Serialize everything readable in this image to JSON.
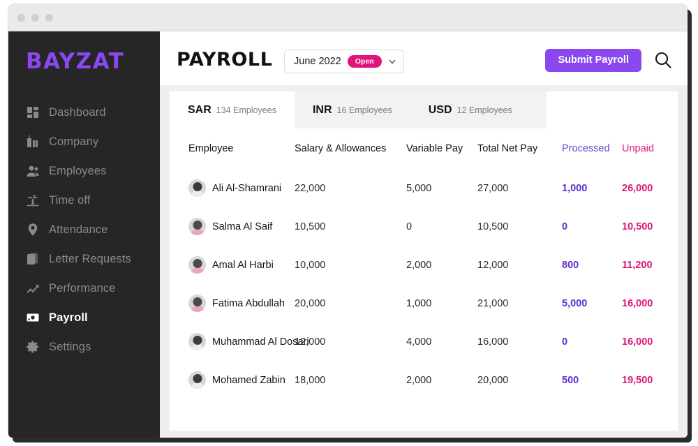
{
  "window": {
    "traffic_lights": [
      "close",
      "minimize",
      "maximize"
    ]
  },
  "sidebar": {
    "logo": "BAYZAT",
    "logo_color": "#8b47f0",
    "items": [
      {
        "label": "Dashboard",
        "icon": "dashboard-icon",
        "active": false
      },
      {
        "label": "Company",
        "icon": "building-icon",
        "active": false
      },
      {
        "label": "Employees",
        "icon": "people-icon",
        "active": false
      },
      {
        "label": "Time off",
        "icon": "palm-tree-icon",
        "active": false
      },
      {
        "label": "Attendance",
        "icon": "map-pin-icon",
        "active": false
      },
      {
        "label": "Letter Requests",
        "icon": "document-icon",
        "active": false
      },
      {
        "label": "Performance",
        "icon": "trending-up-icon",
        "active": false
      },
      {
        "label": "Payroll",
        "icon": "money-card-icon",
        "active": true
      },
      {
        "label": "Settings",
        "icon": "gear-icon",
        "active": false
      }
    ]
  },
  "header": {
    "title": "PAYROLL",
    "period": {
      "label": "June 2022",
      "status": "Open",
      "status_color": "#e0157c",
      "chevron": "chevron-down-icon"
    },
    "submit_label": "Submit Payroll",
    "submit_color": "#8b47f0",
    "search_icon": "search-icon"
  },
  "tabs": [
    {
      "code": "SAR",
      "count": "134 Employees",
      "active": true
    },
    {
      "code": "INR",
      "count": "16 Employees",
      "active": false
    },
    {
      "code": "USD",
      "count": "12 Employees",
      "active": false
    }
  ],
  "table": {
    "columns": [
      {
        "key": "employee",
        "label": "Employee",
        "color": "#121212"
      },
      {
        "key": "salary",
        "label": "Salary & Allowances",
        "color": "#121212"
      },
      {
        "key": "variable",
        "label": "Variable Pay",
        "color": "#121212"
      },
      {
        "key": "total",
        "label": "Total Net Pay",
        "color": "#121212"
      },
      {
        "key": "processed",
        "label": "Processed",
        "color": "#6b45d4"
      },
      {
        "key": "unpaid",
        "label": "Unpaid",
        "color": "#e0157c"
      }
    ],
    "rows": [
      {
        "employee": "Ali Al-Shamrani",
        "avatar": "m",
        "salary": "22,000",
        "variable": "5,000",
        "total": "27,000",
        "processed": "1,000",
        "unpaid": "26,000"
      },
      {
        "employee": "Salma Al Saif",
        "avatar": "f",
        "salary": "10,500",
        "variable": "0",
        "total": "10,500",
        "processed": "0",
        "unpaid": "10,500"
      },
      {
        "employee": "Amal Al Harbi",
        "avatar": "f",
        "salary": "10,000",
        "variable": "2,000",
        "total": "12,000",
        "processed": "800",
        "unpaid": "11,200"
      },
      {
        "employee": "Fatima Abdullah",
        "avatar": "f",
        "salary": "20,000",
        "variable": "1,000",
        "total": "21,000",
        "processed": "5,000",
        "unpaid": "16,000"
      },
      {
        "employee": "Muhammad Al Dosari",
        "avatar": "m",
        "salary": "12,000",
        "variable": "4,000",
        "total": "16,000",
        "processed": "0",
        "unpaid": "16,000"
      },
      {
        "employee": "Mohamed Zabin",
        "avatar": "m",
        "salary": "18,000",
        "variable": "2,000",
        "total": "20,000",
        "processed": "500",
        "unpaid": "19,500"
      }
    ]
  }
}
